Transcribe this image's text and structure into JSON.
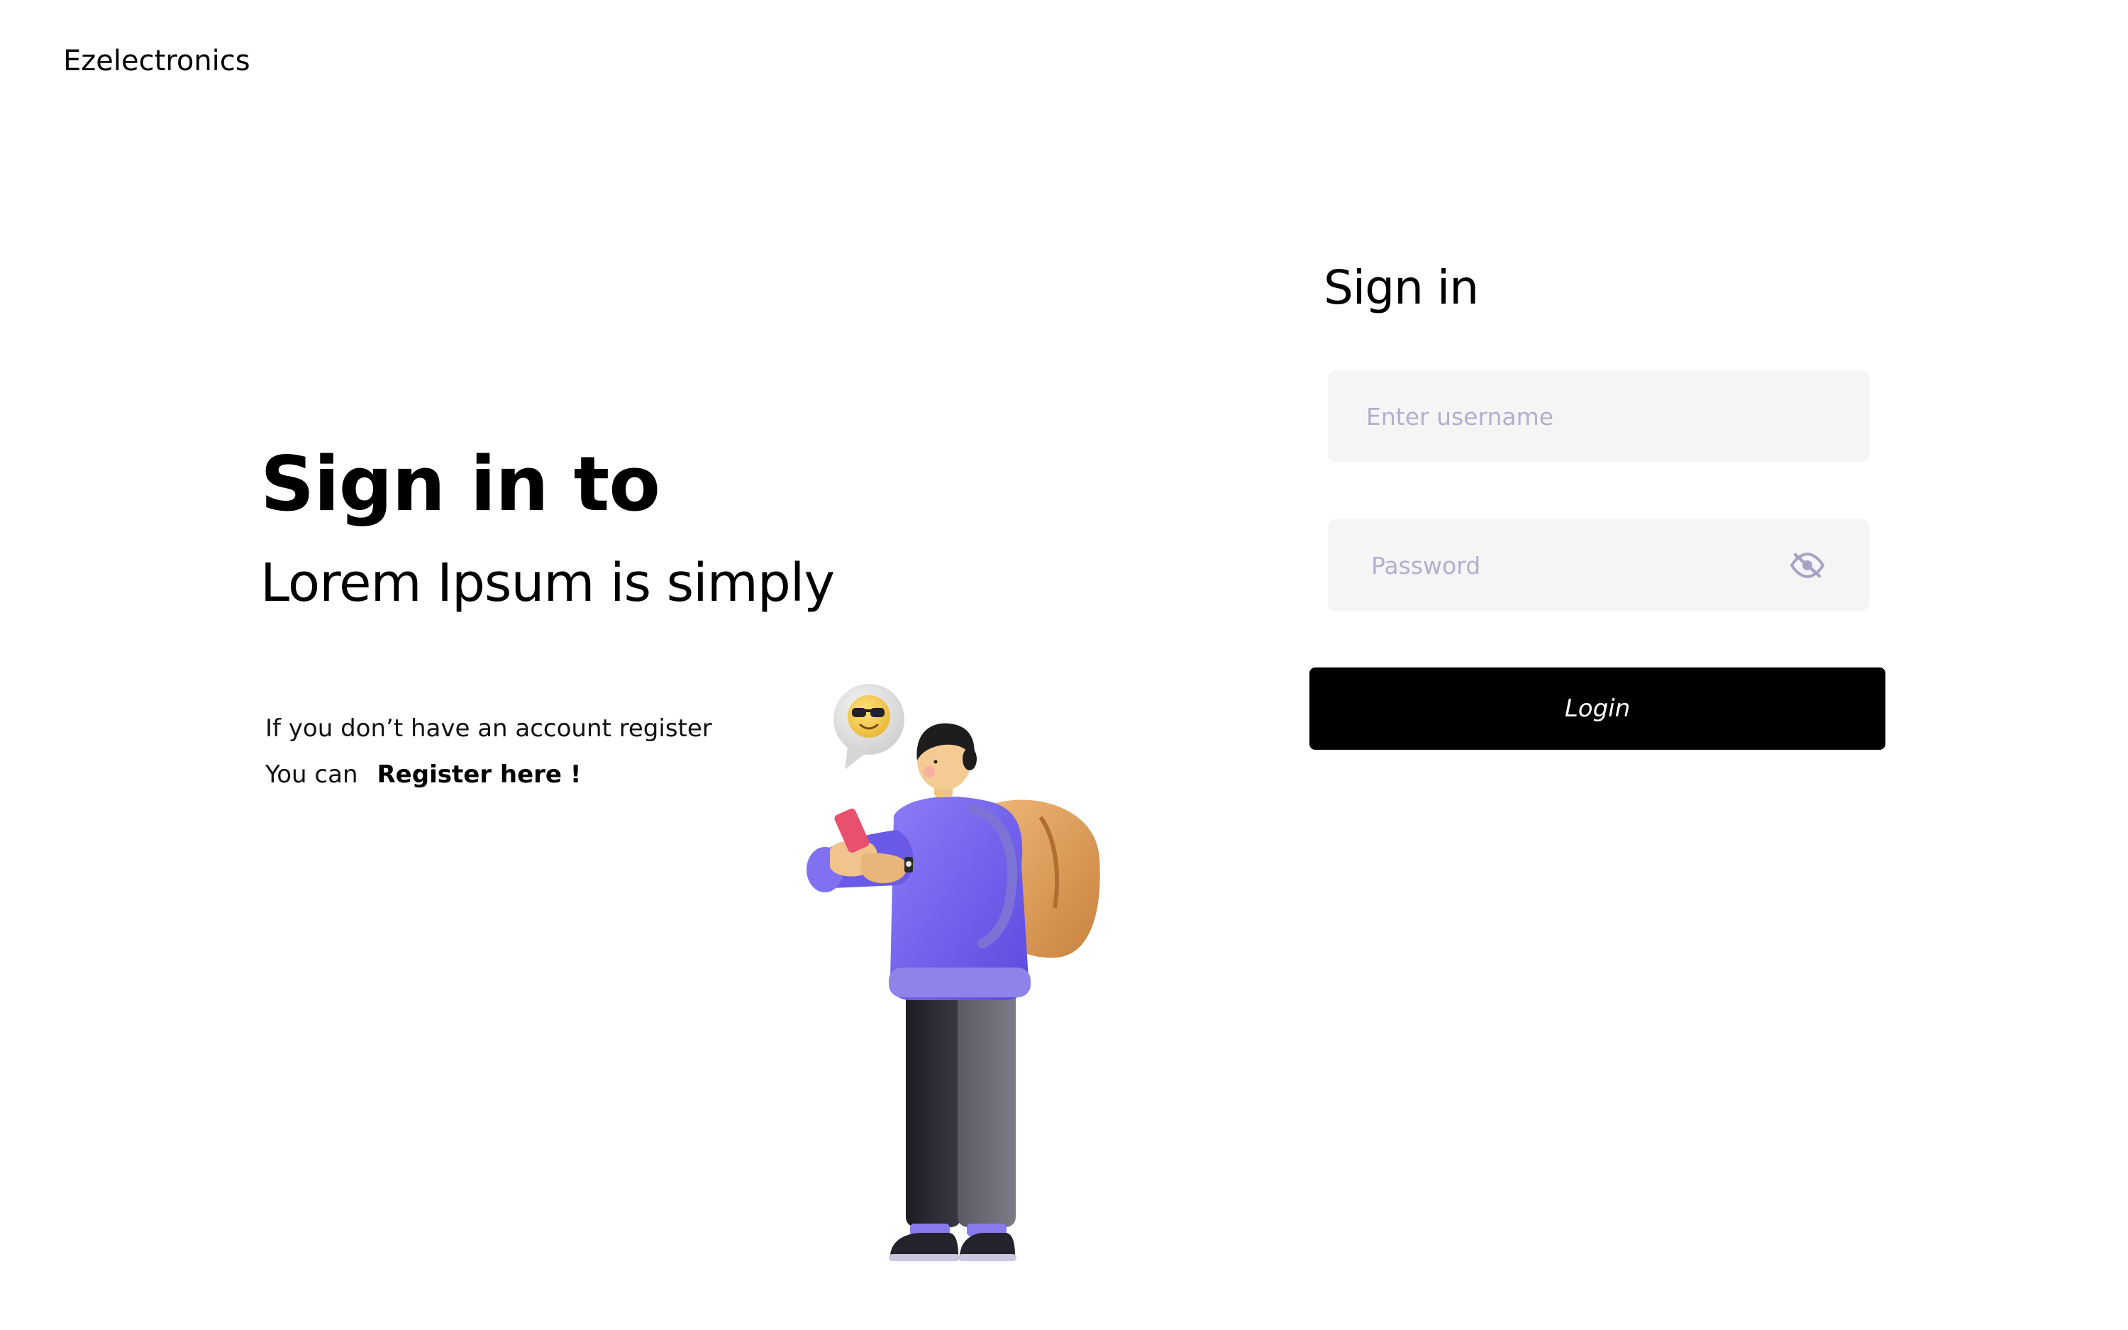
{
  "brand": {
    "name": "Ezelectronics"
  },
  "hero": {
    "title": "Sign in to",
    "subtitle": "Lorem Ipsum is simply",
    "register_line_1": "If you don’t have an account register",
    "register_prefix": "You can",
    "register_link": "Register here !"
  },
  "signin": {
    "heading": "Sign in",
    "username": {
      "value": "",
      "placeholder": "Enter username"
    },
    "password": {
      "value": "",
      "placeholder": "Password"
    },
    "password_toggle_icon": "eye-slash-icon",
    "login_label": "Login"
  },
  "colors": {
    "background": "#ffffff",
    "input_background": "#f5f5f5",
    "placeholder": "#b3aed0",
    "button_background": "#000000",
    "button_text": "#ffffff",
    "icon": "#a8a3c4"
  }
}
